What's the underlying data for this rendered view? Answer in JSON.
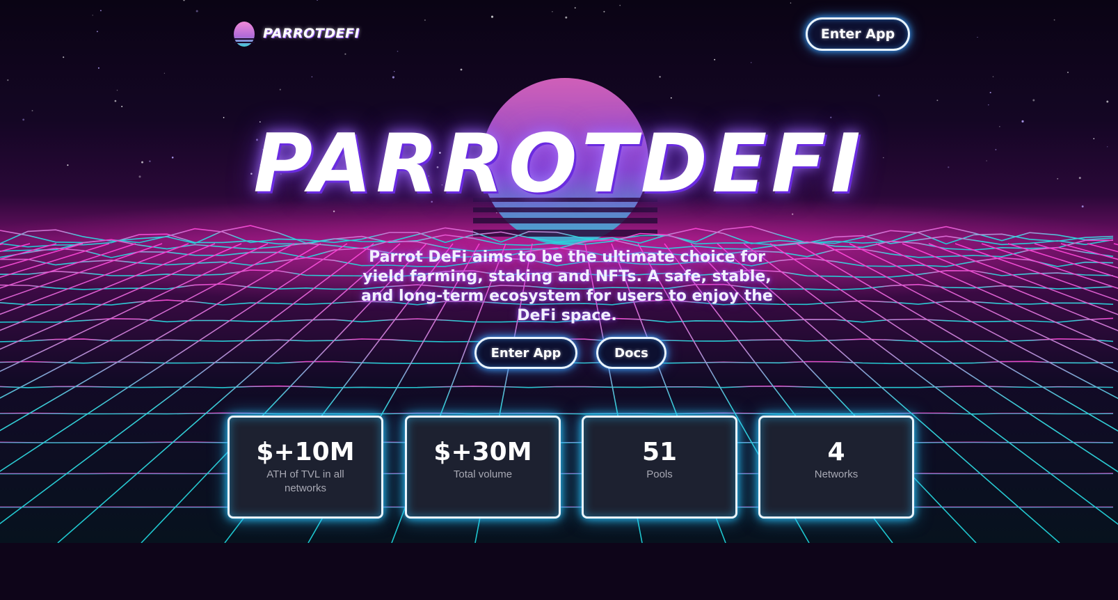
{
  "nav": {
    "logo_text": "PARROTDEFI",
    "enter_app": "Enter App"
  },
  "hero": {
    "title": "PARROTDEFI",
    "tagline": "Parrot DeFi aims to be the ultimate choice for yield farming, staking and NFTs. A safe, stable, and long-term ecosystem for users to enjoy the DeFi space.",
    "enter_app": "Enter App",
    "docs": "Docs"
  },
  "stats": [
    {
      "value": "$+10M",
      "label": "ATH of TVL in all networks"
    },
    {
      "value": "$+30M",
      "label": "Total volume"
    },
    {
      "value": "51",
      "label": "Pools"
    },
    {
      "value": "4",
      "label": "Networks"
    }
  ],
  "colors": {
    "neon_blue": "#29c4ff",
    "neon_purple": "#7b2ff7",
    "grid_pink": "#ff4fd8",
    "grid_cyan": "#2ee6e6",
    "card_bg": "#1d2130",
    "page_bg": "#0d0518"
  },
  "icons": {
    "logo": "retro-sun-egg-icon"
  }
}
